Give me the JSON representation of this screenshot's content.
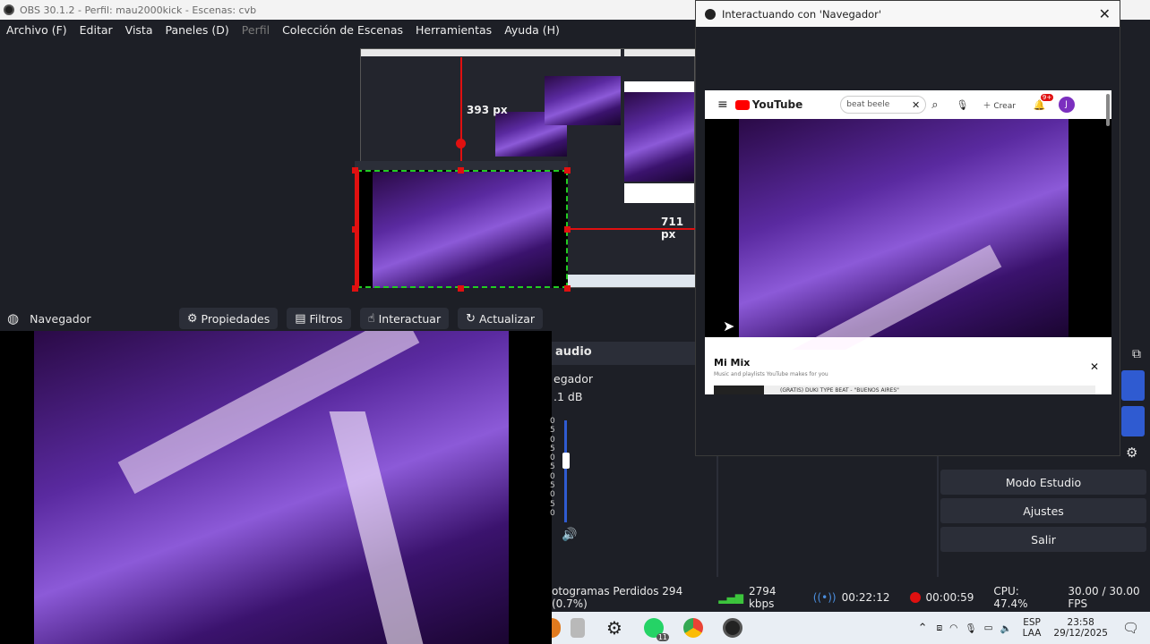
{
  "window": {
    "title": "OBS 30.1.2 - Perfil: mau2000kick - Escenas: cvb"
  },
  "menu": {
    "items": [
      {
        "label": "Archivo (F)",
        "enabled": true
      },
      {
        "label": "Editar",
        "enabled": true
      },
      {
        "label": "Vista",
        "enabled": true
      },
      {
        "label": "Paneles (D)",
        "enabled": true
      },
      {
        "label": "Perfil",
        "enabled": false
      },
      {
        "label": "Colección de Escenas",
        "enabled": true
      },
      {
        "label": "Herramientas",
        "enabled": true
      },
      {
        "label": "Ayuda (H)",
        "enabled": true
      }
    ]
  },
  "preview": {
    "dim_top": "393 px",
    "dim_right": "711 px"
  },
  "source_toolbar": {
    "source_name": "Navegador",
    "properties": "Propiedades",
    "filters": "Filtros",
    "interact": "Interactuar",
    "refresh": "Actualizar"
  },
  "mixer": {
    "header": "audio",
    "source": "egador",
    "level": ".1 dB",
    "scale": [
      "0",
      "5",
      "0",
      "5",
      "0",
      "5",
      "0",
      "5",
      "0",
      "5",
      "0"
    ]
  },
  "controls": {
    "studio_mode": "Modo Estudio",
    "settings": "Ajustes",
    "exit": "Salir"
  },
  "status": {
    "dropped": "otogramas Perdidos 294 (0.7%)",
    "bitrate": "2794 kbps",
    "stream_time": "00:22:12",
    "rec_time": "00:00:59",
    "cpu": "CPU: 47.4%",
    "fps": "30.00 / 30.00 FPS"
  },
  "taskbar": {
    "lang_top": "ESP",
    "lang_bottom": "LAA",
    "time": "23:58",
    "date": "29/12/2025",
    "whatsapp_badge": "11"
  },
  "dialog": {
    "title": "Interactuando con 'Navegador'",
    "youtube": {
      "logo": "YouTube",
      "search_value": "beat beele",
      "create_label": "Crear",
      "notif_badge": "9+",
      "avatar_letter": "J",
      "mix_title": "Mi Mix",
      "mix_subtitle": "Music and playlists YouTube makes for you",
      "mix_item": "(GRATIS) DUKI TYPE BEAT - \"BUENOS AIRES\""
    }
  },
  "colors": {
    "accent_red": "#e01010",
    "selection_green": "#22cc22",
    "obs_bg": "#1d1f26",
    "button_blue": "#2f5bd1"
  }
}
